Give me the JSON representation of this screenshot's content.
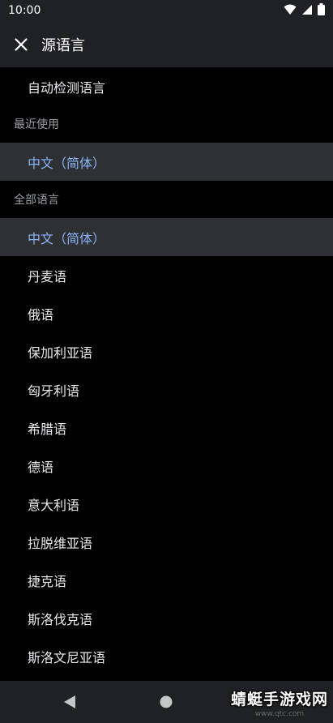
{
  "status_bar": {
    "time": "10:00",
    "icons": [
      "wifi-icon",
      "signal-icon",
      "battery-icon"
    ]
  },
  "header": {
    "close_icon": "close-icon",
    "title": "源语言"
  },
  "auto_detect": {
    "label": "自动检测语言"
  },
  "recent": {
    "header": "最近使用",
    "items": [
      {
        "label": "中文（简体）"
      }
    ]
  },
  "all_languages": {
    "header": "全部语言",
    "items": [
      {
        "label": "中文（简体）"
      },
      {
        "label": "丹麦语"
      },
      {
        "label": "俄语"
      },
      {
        "label": "保加利亚语"
      },
      {
        "label": "匈牙利语"
      },
      {
        "label": "希腊语"
      },
      {
        "label": "德语"
      },
      {
        "label": "意大利语"
      },
      {
        "label": "拉脱维亚语"
      },
      {
        "label": "捷克语"
      },
      {
        "label": "斯洛伐克语"
      },
      {
        "label": "斯洛文尼亚语"
      }
    ]
  },
  "colors": {
    "selected_text": "#8ab4f8",
    "selected_bg": "#2f3033",
    "bar_bg": "#202124"
  },
  "nav_bar": {
    "icons": [
      "back-icon",
      "home-icon"
    ]
  },
  "watermark": {
    "text": "蜻蜓手游戏网",
    "url": "www.qtc.com"
  }
}
